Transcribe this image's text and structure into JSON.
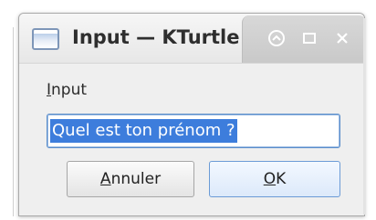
{
  "window": {
    "title": "Input — KTurtle",
    "icon": "app-window-icon",
    "controls": {
      "minimize_icon": "minimize-icon",
      "maximize_icon": "maximize-icon",
      "close_icon": "close-icon"
    }
  },
  "form": {
    "label_mnemonic": "I",
    "label_rest": "nput",
    "input_value": "Quel est ton prénom ?"
  },
  "buttons": {
    "cancel_mnemonic": "A",
    "cancel_rest": "nnuler",
    "ok_mnemonic": "O",
    "ok_rest": "K"
  },
  "colors": {
    "selection": "#3d7ddc",
    "focus_border": "#5b8ecb",
    "window_bg": "#efefef"
  }
}
